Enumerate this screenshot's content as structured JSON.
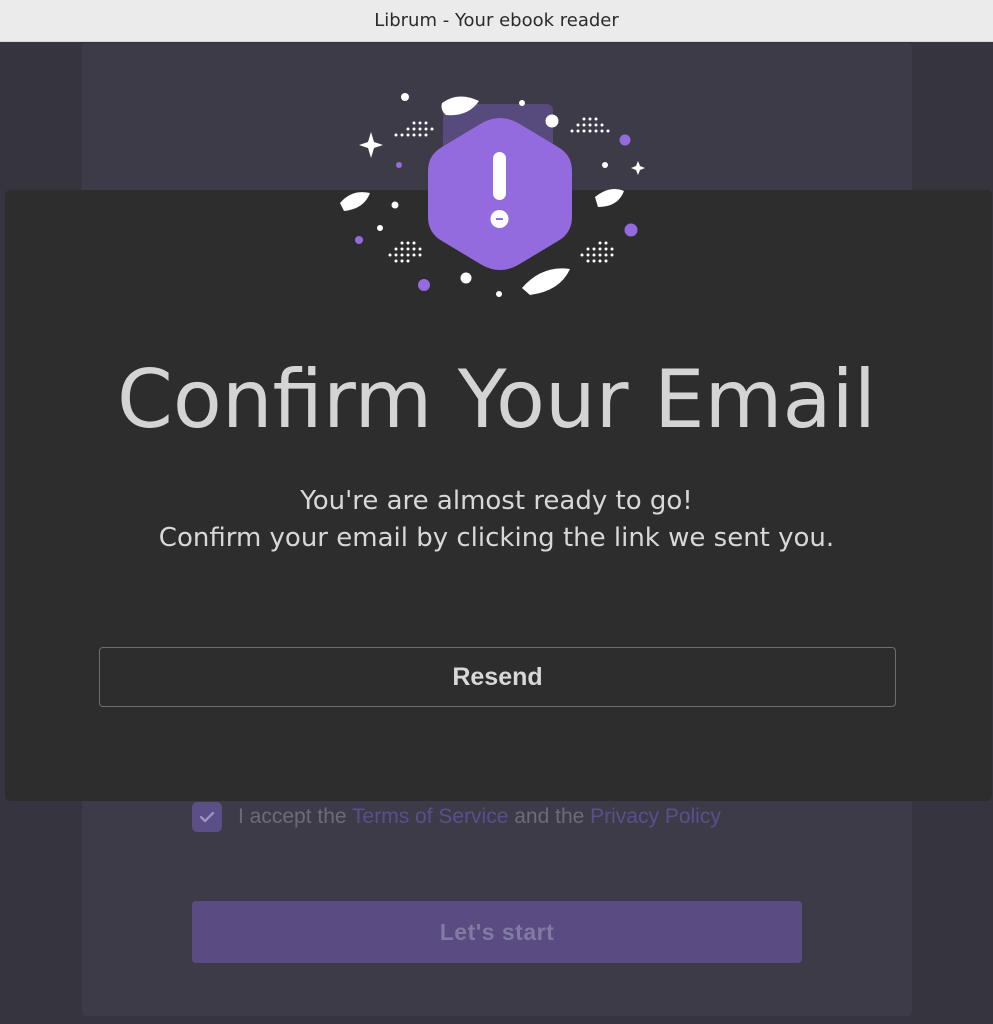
{
  "window": {
    "title": "Librum - Your ebook reader"
  },
  "background_page": {
    "terms": {
      "checked": true,
      "prefix": "I accept the ",
      "terms_link": "Terms of Service",
      "middle": " and the ",
      "privacy_link": "Privacy Policy"
    },
    "start_button_label": "Let's start"
  },
  "modal": {
    "illustration_icon": "exclamation-icon",
    "title": "Confirm Your Email",
    "message_line1": "You're are almost ready to go!",
    "message_line2": "Confirm your email by clicking the link we sent you.",
    "resend_button_label": "Resend"
  },
  "colors": {
    "accent": "#946bde",
    "modal_background": "#2d2d2d",
    "page_background": "#36343f",
    "link_color": "#5a4f8c"
  }
}
